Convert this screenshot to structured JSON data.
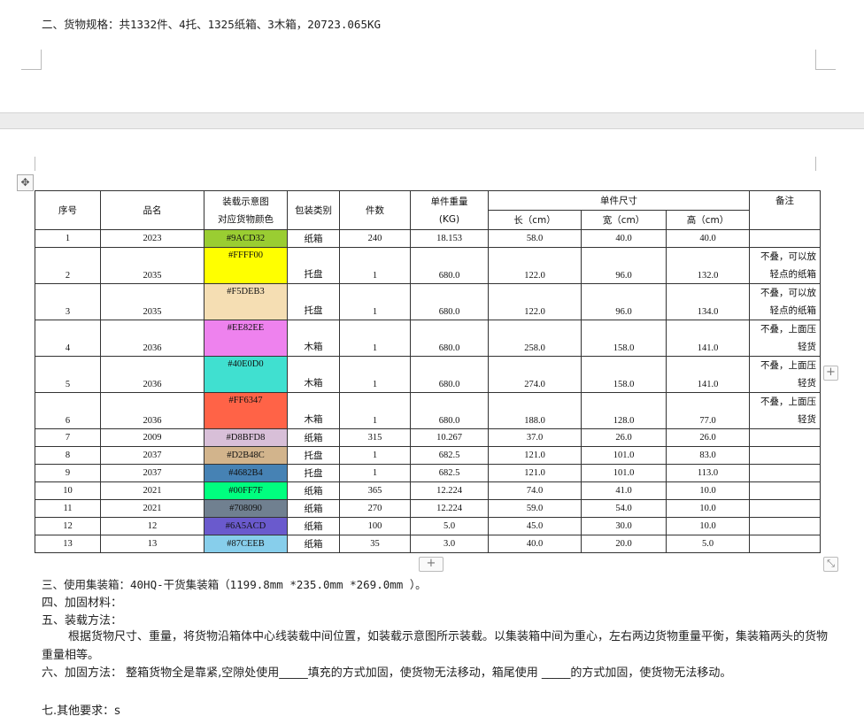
{
  "spec_line": "二、货物规格：共1332件、4托、1325纸箱、3木箱，20723.065KG",
  "headers": {
    "seq": "序号",
    "name": "品名",
    "color_1": "装载示意图",
    "color_2": "对应货物颜色",
    "pkg": "包装类别",
    "qty": "件数",
    "weight_1": "单件重量",
    "weight_2": "(KG)",
    "size": "单件尺寸",
    "len": "长（cm）",
    "wid": "宽（cm）",
    "hei": "高（cm）",
    "note": "备注"
  },
  "rows": [
    {
      "seq": "1",
      "name": "2023",
      "color": "#9ACD32",
      "pkg": "纸箱",
      "qty": "240",
      "w": "18.153",
      "l": "58.0",
      "wd": "40.0",
      "h": "40.0",
      "n1": "",
      "n2": ""
    },
    {
      "seq": "2",
      "name": "2035",
      "color": "#FFFF00",
      "pkg": "托盘",
      "qty": "1",
      "w": "680.0",
      "l": "122.0",
      "wd": "96.0",
      "h": "132.0",
      "n1": "不叠，可以放",
      "n2": "轻点的纸箱"
    },
    {
      "seq": "3",
      "name": "2035",
      "color": "#F5DEB3",
      "pkg": "托盘",
      "qty": "1",
      "w": "680.0",
      "l": "122.0",
      "wd": "96.0",
      "h": "134.0",
      "n1": "不叠，可以放",
      "n2": "轻点的纸箱"
    },
    {
      "seq": "4",
      "name": "2036",
      "color": "#EE82EE",
      "pkg": "木箱",
      "qty": "1",
      "w": "680.0",
      "l": "258.0",
      "wd": "158.0",
      "h": "141.0",
      "n1": "不叠，上面压",
      "n2": "轻货"
    },
    {
      "seq": "5",
      "name": "2036",
      "color": "#40E0D0",
      "pkg": "木箱",
      "qty": "1",
      "w": "680.0",
      "l": "274.0",
      "wd": "158.0",
      "h": "141.0",
      "n1": "不叠，上面压",
      "n2": "轻货"
    },
    {
      "seq": "6",
      "name": "2036",
      "color": "#FF6347",
      "pkg": "木箱",
      "qty": "1",
      "w": "680.0",
      "l": "188.0",
      "wd": "128.0",
      "h": "77.0",
      "n1": "不叠，上面压",
      "n2": "轻货"
    },
    {
      "seq": "7",
      "name": "2009",
      "color": "#D8BFD8",
      "pkg": "纸箱",
      "qty": "315",
      "w": "10.267",
      "l": "37.0",
      "wd": "26.0",
      "h": "26.0",
      "n1": "",
      "n2": ""
    },
    {
      "seq": "8",
      "name": "2037",
      "color": "#D2B48C",
      "pkg": "托盘",
      "qty": "1",
      "w": "682.5",
      "l": "121.0",
      "wd": "101.0",
      "h": "83.0",
      "n1": "",
      "n2": ""
    },
    {
      "seq": "9",
      "name": "2037",
      "color": "#4682B4",
      "pkg": "托盘",
      "qty": "1",
      "w": "682.5",
      "l": "121.0",
      "wd": "101.0",
      "h": "113.0",
      "n1": "",
      "n2": ""
    },
    {
      "seq": "10",
      "name": "2021",
      "color": "#00FF7F",
      "pkg": "纸箱",
      "qty": "365",
      "w": "12.224",
      "l": "74.0",
      "wd": "41.0",
      "h": "10.0",
      "n1": "",
      "n2": ""
    },
    {
      "seq": "11",
      "name": "2021",
      "color": "#708090",
      "pkg": "纸箱",
      "qty": "270",
      "w": "12.224",
      "l": "59.0",
      "wd": "54.0",
      "h": "10.0",
      "n1": "",
      "n2": ""
    },
    {
      "seq": "12",
      "name": "12",
      "color": "#6A5ACD",
      "pkg": "纸箱",
      "qty": "100",
      "w": "5.0",
      "l": "45.0",
      "wd": "30.0",
      "h": "10.0",
      "n1": "",
      "n2": ""
    },
    {
      "seq": "13",
      "name": "13",
      "color": "#87CEEB",
      "pkg": "纸箱",
      "qty": "35",
      "w": "3.0",
      "l": "40.0",
      "wd": "20.0",
      "h": "5.0",
      "n1": "",
      "n2": ""
    }
  ],
  "sec3": "三、使用集装箱：40HQ-干货集装箱（1199.8mm *235.0mm *269.0mm ）。",
  "sec4": "四、加固材料：",
  "sec5_title": "五、装载方法：",
  "sec5_body": "根据货物尺寸、重量，将货物沿箱体中心线装载中间位置，如装载示意图所示装载。以集装箱中间为重心，左右两边货物重量平衡，集装箱两头的货物重量相等。",
  "sec6": "六、加固方法： 整箱货物全是靠紧,空隙处使用_____填充的方式加固，使货物无法移动，箱尾使用 _____的方式加固，使货物无法移动。",
  "sec7": "七.其他要求：s",
  "ui": {
    "move_handle": "✥",
    "add_row": "+",
    "add_col": "+",
    "resize": "⤡"
  }
}
